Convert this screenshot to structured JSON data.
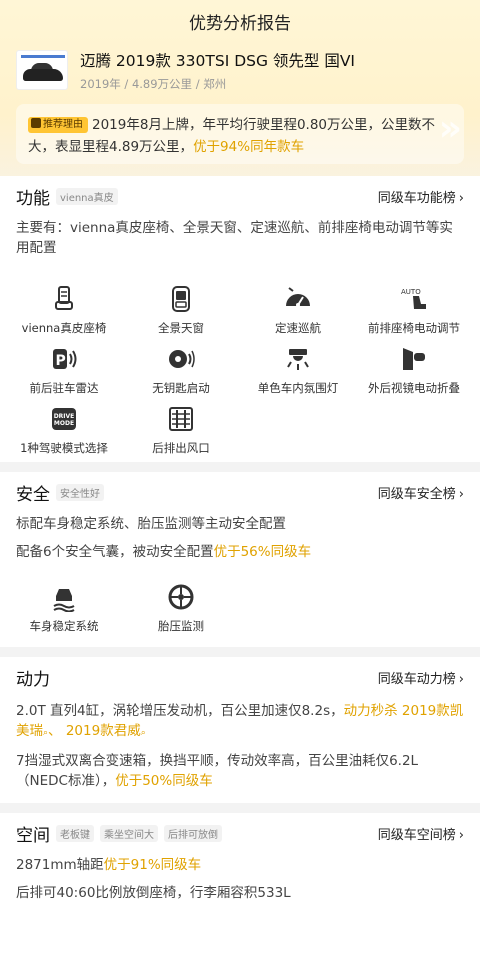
{
  "page_title": "优势分析报告",
  "car": {
    "name": "迈腾 2019款 330TSI DSG 领先型 国VI",
    "meta": "2019年 / 4.89万公里 / 郑州"
  },
  "reason": {
    "tag": "推荐理由",
    "text": "2019年8月上牌，年平均行驶里程0.80万公里，公里数不大，表显里程4.89万公里，",
    "highlight": "优于94%同年款车"
  },
  "function_section": {
    "title": "功能",
    "badge": "vienna真皮",
    "rank_link": "同级车功能榜",
    "description": "主要有：vienna真皮座椅、全景天窗、定速巡航、前排座椅电动调节等实用配置",
    "features": [
      {
        "label": "vienna真皮座椅",
        "icon": "seat-icon"
      },
      {
        "label": "全景天窗",
        "icon": "sunroof-icon"
      },
      {
        "label": "定速巡航",
        "icon": "cruise-control-icon"
      },
      {
        "label": "前排座椅电动调节",
        "icon": "seat-adjust-icon"
      },
      {
        "label": "前后驻车雷达",
        "icon": "parking-radar-icon"
      },
      {
        "label": "无钥匙启动",
        "icon": "keyless-start-icon"
      },
      {
        "label": "单色车内氛围灯",
        "icon": "ambient-light-icon"
      },
      {
        "label": "外后视镜电动折叠",
        "icon": "mirror-fold-icon"
      },
      {
        "label": "1种驾驶模式选择",
        "icon": "drive-mode-icon"
      },
      {
        "label": "后排出风口",
        "icon": "rear-vent-icon"
      }
    ]
  },
  "safety_section": {
    "title": "安全",
    "badge": "安全性好",
    "rank_link": "同级车安全榜",
    "line1": "标配车身稳定系统、胎压监测等主动安全配置",
    "line2_text": "配备6个安全气囊，被动安全配置",
    "line2_highlight": "优于56%同级车",
    "features": [
      {
        "label": "车身稳定系统",
        "icon": "stability-control-icon"
      },
      {
        "label": "胎压监测",
        "icon": "tire-pressure-icon"
      }
    ]
  },
  "power_section": {
    "title": "动力",
    "rank_link": "同级车动力榜",
    "line1_text": "2.0T 直列4缸，涡轮增压发动机，百公里加速仅8.2s，",
    "line1_highlight": "动力秒杀 2019款凯美瑞",
    "line1_highlight2": "、 2019款君威",
    "line2_text": "7挡湿式双离合变速箱，换挡平顺，传动效率高，百公里油耗仅6.2L（NEDC标准），",
    "line2_highlight": "优于50%同级车"
  },
  "space_section": {
    "title": "空间",
    "badges": [
      "老板键",
      "乘坐空间大",
      "后排可放倒"
    ],
    "rank_link": "同级车空间榜",
    "line1_text": "2871mm轴距",
    "line1_highlight": "优于91%同级车",
    "line2": "后排可40:60比例放倒座椅，行李厢容积533L"
  },
  "colors": {
    "accent": "#e0a200",
    "tag": "#ffc533",
    "header_bg": "#fff4d2"
  }
}
